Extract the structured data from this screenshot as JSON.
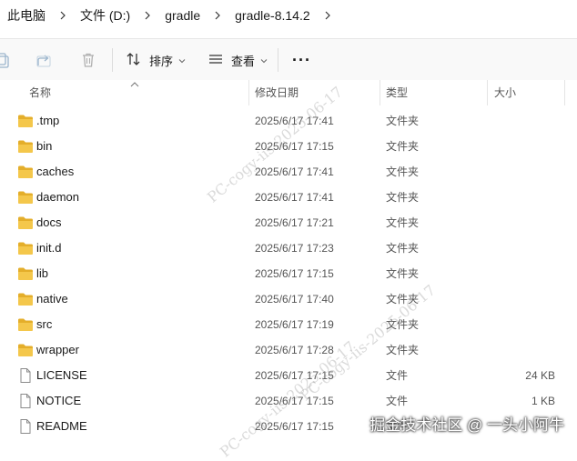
{
  "breadcrumb": {
    "items": [
      "此电脑",
      "文件 (D:)",
      "gradle",
      "gradle-8.14.2"
    ]
  },
  "toolbar": {
    "sort_label": "排序",
    "view_label": "查看",
    "more_label": "···"
  },
  "columns": {
    "name": "名称",
    "date": "修改日期",
    "type": "类型",
    "size": "大小"
  },
  "files": [
    {
      "name": ".tmp",
      "date": "2025/6/17 17:41",
      "type": "文件夹",
      "size": "",
      "kind": "folder"
    },
    {
      "name": "bin",
      "date": "2025/6/17 17:15",
      "type": "文件夹",
      "size": "",
      "kind": "folder"
    },
    {
      "name": "caches",
      "date": "2025/6/17 17:41",
      "type": "文件夹",
      "size": "",
      "kind": "folder"
    },
    {
      "name": "daemon",
      "date": "2025/6/17 17:41",
      "type": "文件夹",
      "size": "",
      "kind": "folder"
    },
    {
      "name": "docs",
      "date": "2025/6/17 17:21",
      "type": "文件夹",
      "size": "",
      "kind": "folder"
    },
    {
      "name": "init.d",
      "date": "2025/6/17 17:23",
      "type": "文件夹",
      "size": "",
      "kind": "folder"
    },
    {
      "name": "lib",
      "date": "2025/6/17 17:15",
      "type": "文件夹",
      "size": "",
      "kind": "folder"
    },
    {
      "name": "native",
      "date": "2025/6/17 17:40",
      "type": "文件夹",
      "size": "",
      "kind": "folder"
    },
    {
      "name": "src",
      "date": "2025/6/17 17:19",
      "type": "文件夹",
      "size": "",
      "kind": "folder"
    },
    {
      "name": "wrapper",
      "date": "2025/6/17 17:28",
      "type": "文件夹",
      "size": "",
      "kind": "folder"
    },
    {
      "name": "LICENSE",
      "date": "2025/6/17 17:15",
      "type": "文件",
      "size": "24 KB",
      "kind": "file"
    },
    {
      "name": "NOTICE",
      "date": "2025/6/17 17:15",
      "type": "文件",
      "size": "1 KB",
      "kind": "file"
    },
    {
      "name": "README",
      "date": "2025/6/17 17:15",
      "type": "文件",
      "size": "",
      "kind": "file"
    }
  ],
  "watermark": {
    "text1": "PC-cogy-iis-2025-06-17",
    "text2": "PC-cogy-iis-2025-06-17",
    "text3": "PC-cogy-iis-2025-06-17"
  },
  "overlay": {
    "text": "掘金技术社区 @ 一头小阿牛"
  },
  "colors": {
    "folder": "#f4c74b",
    "folder_dark": "#e4ae2a",
    "toolbar_bg": "#f9f9f9"
  }
}
